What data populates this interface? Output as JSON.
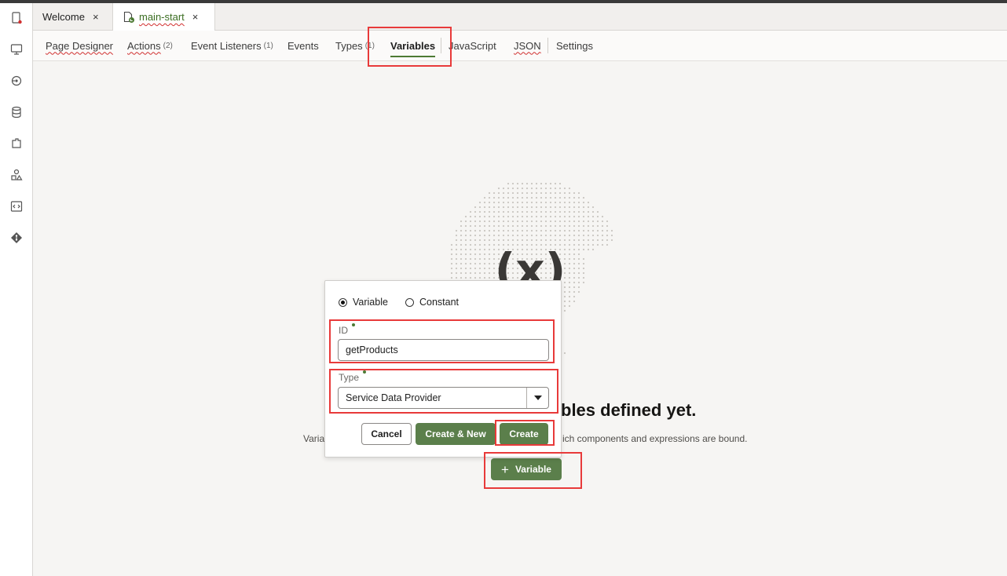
{
  "tabs": [
    {
      "label": "Welcome",
      "close": "×"
    },
    {
      "label": "main-start",
      "close": "×"
    }
  ],
  "subnav": {
    "page_designer": "Page Designer",
    "actions": "Actions",
    "actions_count": "(2)",
    "event_listeners": "Event Listeners",
    "event_listeners_count": "(1)",
    "events": "Events",
    "types": "Types",
    "types_count": "(1)",
    "variables": "Variables",
    "javascript": "JavaScript",
    "json": "JSON",
    "settings": "Settings"
  },
  "empty": {
    "art_label": "(x)",
    "title_visible": "bles defined yet.",
    "desc_left": "Varia",
    "desc_right": "ich components and expressions are bound.",
    "add_button": "Variable",
    "add_icon": "plus-icon"
  },
  "dialog": {
    "radio_variable": "Variable",
    "radio_constant": "Constant",
    "selected": "Variable",
    "id_label": "ID",
    "id_value": "getProducts",
    "type_label": "Type",
    "type_value": "Service Data Provider",
    "cancel": "Cancel",
    "create_new": "Create & New",
    "create": "Create"
  },
  "colors": {
    "accent_green": "#5b7f4b",
    "highlight_red": "#e83a3a",
    "active_tab_text": "#3b6e22"
  }
}
